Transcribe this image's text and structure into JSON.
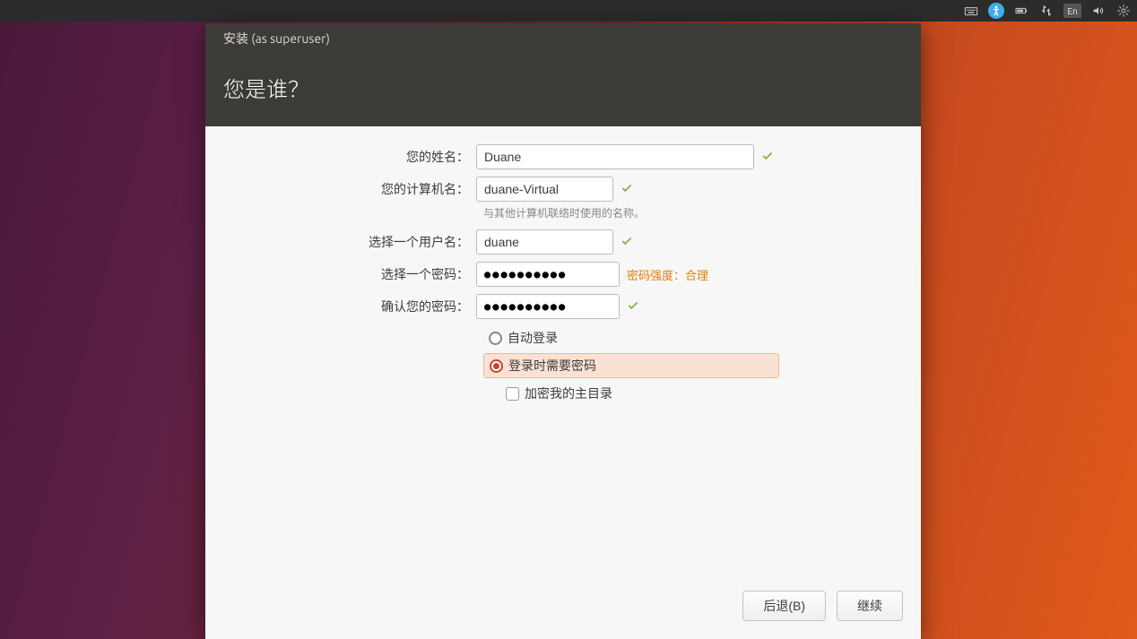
{
  "topbar": {
    "lang": "En"
  },
  "window": {
    "title": "安装 (as superuser)",
    "heading": "您是谁？"
  },
  "form": {
    "name_label": "您的姓名：",
    "name_value": "Duane",
    "computer_label": "您的计算机名：",
    "computer_value": "duane-Virtual",
    "computer_hint": "与其他计算机联络时使用的名称。",
    "username_label": "选择一个用户名：",
    "username_value": "duane",
    "password_label": "选择一个密码：",
    "password_value": "●●●●●●●●●●",
    "password_strength": "密码强度：合理",
    "confirm_label": "确认您的密码：",
    "confirm_value": "●●●●●●●●●●",
    "auto_login": "自动登录",
    "require_password": "登录时需要密码",
    "encrypt_home": "加密我的主目录"
  },
  "footer": {
    "back": "后退(B)",
    "continue": "继续"
  }
}
